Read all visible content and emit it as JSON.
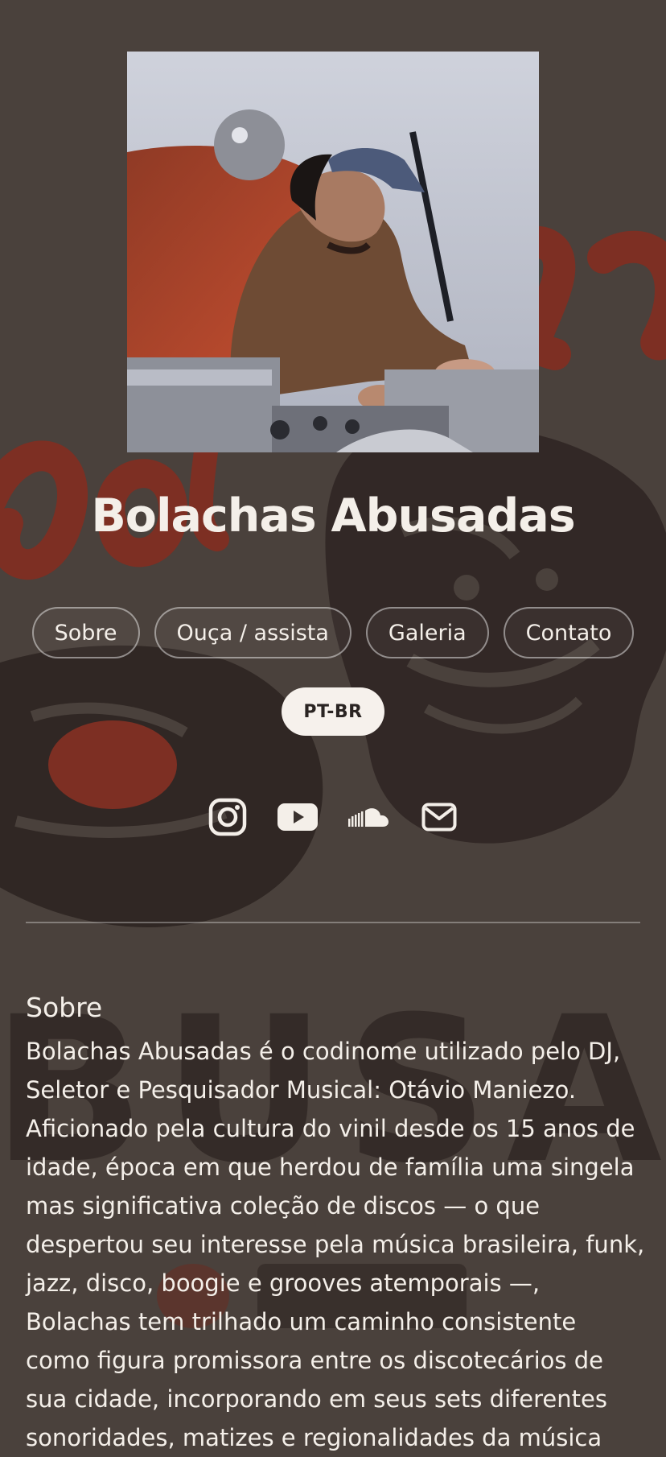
{
  "site": {
    "title": "Bolachas Abusadas"
  },
  "nav": {
    "items": [
      {
        "label": "Sobre"
      },
      {
        "label": "Ouça / assista"
      },
      {
        "label": "Galeria"
      },
      {
        "label": "Contato"
      }
    ],
    "language": "PT-BR"
  },
  "social": [
    {
      "icon": "instagram-icon"
    },
    {
      "icon": "youtube-icon"
    },
    {
      "icon": "soundcloud-icon"
    },
    {
      "icon": "mail-icon"
    }
  ],
  "about": {
    "heading": "Sobre",
    "text": "Bolachas Abusadas é o codinome utilizado pelo DJ, Seletor e Pesquisador Musical: Otávio Maniezo. Aficionado pela cultura do vinil desde os 15 anos de idade, época em que herdou de família uma singela mas significativa coleção de discos — o que despertou seu interesse pela música brasileira, funk, jazz, disco, boogie e grooves atemporais —, Bolachas tem trilhado um caminho consistente como figura promissora entre os discotecários de sua cidade, incorporando em seus sets diferentes sonoridades, matizes e regionalidades da música"
  },
  "background": {
    "word": "BUSADA"
  },
  "colors": {
    "background": "#4a413c",
    "accent_red": "#8a3626",
    "text": "#f4efe9",
    "lang_button_bg": "#f6f1ec"
  }
}
